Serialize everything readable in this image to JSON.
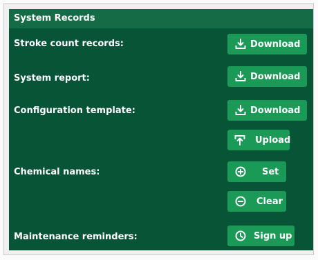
{
  "panel": {
    "title": "System Records"
  },
  "rows": [
    {
      "label": "Stroke count records:",
      "buttons": [
        {
          "label": "Download",
          "icon": "download-icon"
        }
      ]
    },
    {
      "label": "System report:",
      "buttons": [
        {
          "label": "Download",
          "icon": "download-icon"
        }
      ]
    },
    {
      "label": "Configuration template:",
      "buttons": [
        {
          "label": "Download",
          "icon": "download-icon"
        },
        {
          "label": "Upload",
          "icon": "upload-icon"
        }
      ]
    },
    {
      "label": "Chemical names:",
      "buttons": [
        {
          "label": "Set",
          "icon": "plus-circle-icon"
        },
        {
          "label": "Clear",
          "icon": "minus-circle-icon"
        }
      ]
    },
    {
      "label": "Maintenance reminders:",
      "buttons": [
        {
          "label": "Sign up",
          "icon": "clock-icon"
        }
      ]
    }
  ],
  "colors": {
    "panel_background": "#075437",
    "header_background": "#136c45",
    "button_background": "#1b9957",
    "text": "#ffffff"
  }
}
